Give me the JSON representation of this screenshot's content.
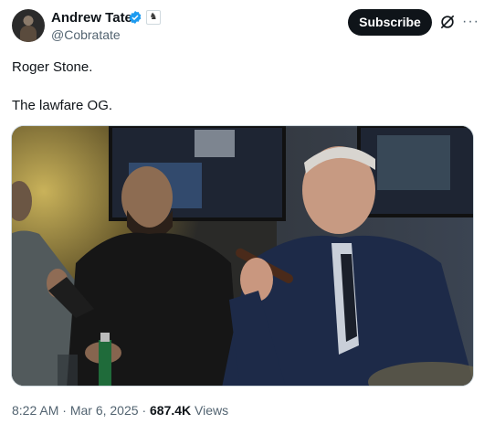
{
  "author": {
    "name": "Andrew Tate",
    "handle": "@Cobratate",
    "verified_color": "#1d9bf0",
    "affiliate_icon": "chess-knight-icon"
  },
  "actions": {
    "subscribe_label": "Subscribe",
    "grok_icon": "grok-icon",
    "more_icon": "more-icon"
  },
  "tweet": {
    "line1": "Roger Stone.",
    "line2": "The lawfare OG."
  },
  "media": {
    "type": "photo"
  },
  "meta": {
    "time": "8:22 AM",
    "separator": "·",
    "date": "Mar 6, 2025",
    "views_count": "687.4K",
    "views_label": "Views"
  }
}
